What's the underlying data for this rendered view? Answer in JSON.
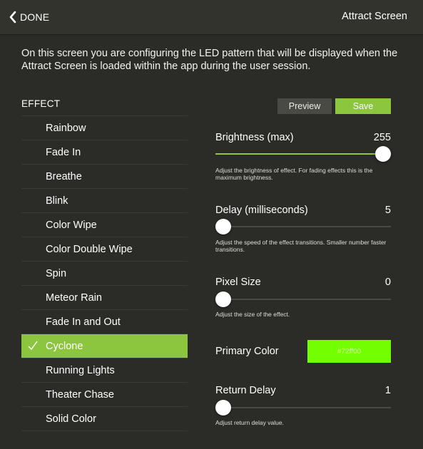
{
  "nav": {
    "back_label": "DONE",
    "title": "Attract Screen"
  },
  "description": "On this screen you are configuring the LED pattern that will be displayed when the Attract Screen is loaded within the app during the user session.",
  "effects": {
    "header": "EFFECT",
    "items": [
      {
        "label": "Rainbow",
        "selected": false
      },
      {
        "label": "Fade In",
        "selected": false
      },
      {
        "label": "Breathe",
        "selected": false
      },
      {
        "label": "Blink",
        "selected": false
      },
      {
        "label": "Color Wipe",
        "selected": false
      },
      {
        "label": "Color Double Wipe",
        "selected": false
      },
      {
        "label": "Spin",
        "selected": false
      },
      {
        "label": "Meteor Rain",
        "selected": false
      },
      {
        "label": "Fade In and Out",
        "selected": false
      },
      {
        "label": "Cyclone",
        "selected": true
      },
      {
        "label": "Running Lights",
        "selected": false
      },
      {
        "label": "Theater Chase",
        "selected": false
      },
      {
        "label": "Solid Color",
        "selected": false
      }
    ]
  },
  "actions": {
    "preview_label": "Preview",
    "save_label": "Save"
  },
  "settings": {
    "brightness": {
      "label": "Brightness (max)",
      "value": "255",
      "level": 1.0,
      "help": "Adjust the brightness of effect. For fading effects this is the maximum brightness."
    },
    "delay": {
      "label": "Delay (milliseconds)",
      "value": "5",
      "level": 0.0,
      "help": "Adjust the speed of the effect transitions. Smaller number faster transitions."
    },
    "pixel_size": {
      "label": "Pixel Size",
      "value": "0",
      "level": 0.0,
      "help": "Adjust the size of the effect."
    },
    "primary_color": {
      "label": "Primary Color",
      "value": "#72ff00"
    },
    "return_delay": {
      "label": "Return Delay",
      "value": "1",
      "level": 0.0,
      "help": "Adjust return delay value."
    }
  },
  "colors": {
    "accent": "#8cc63f",
    "background": "#2b2b27",
    "primary_color_swatch": "#72ff00"
  }
}
